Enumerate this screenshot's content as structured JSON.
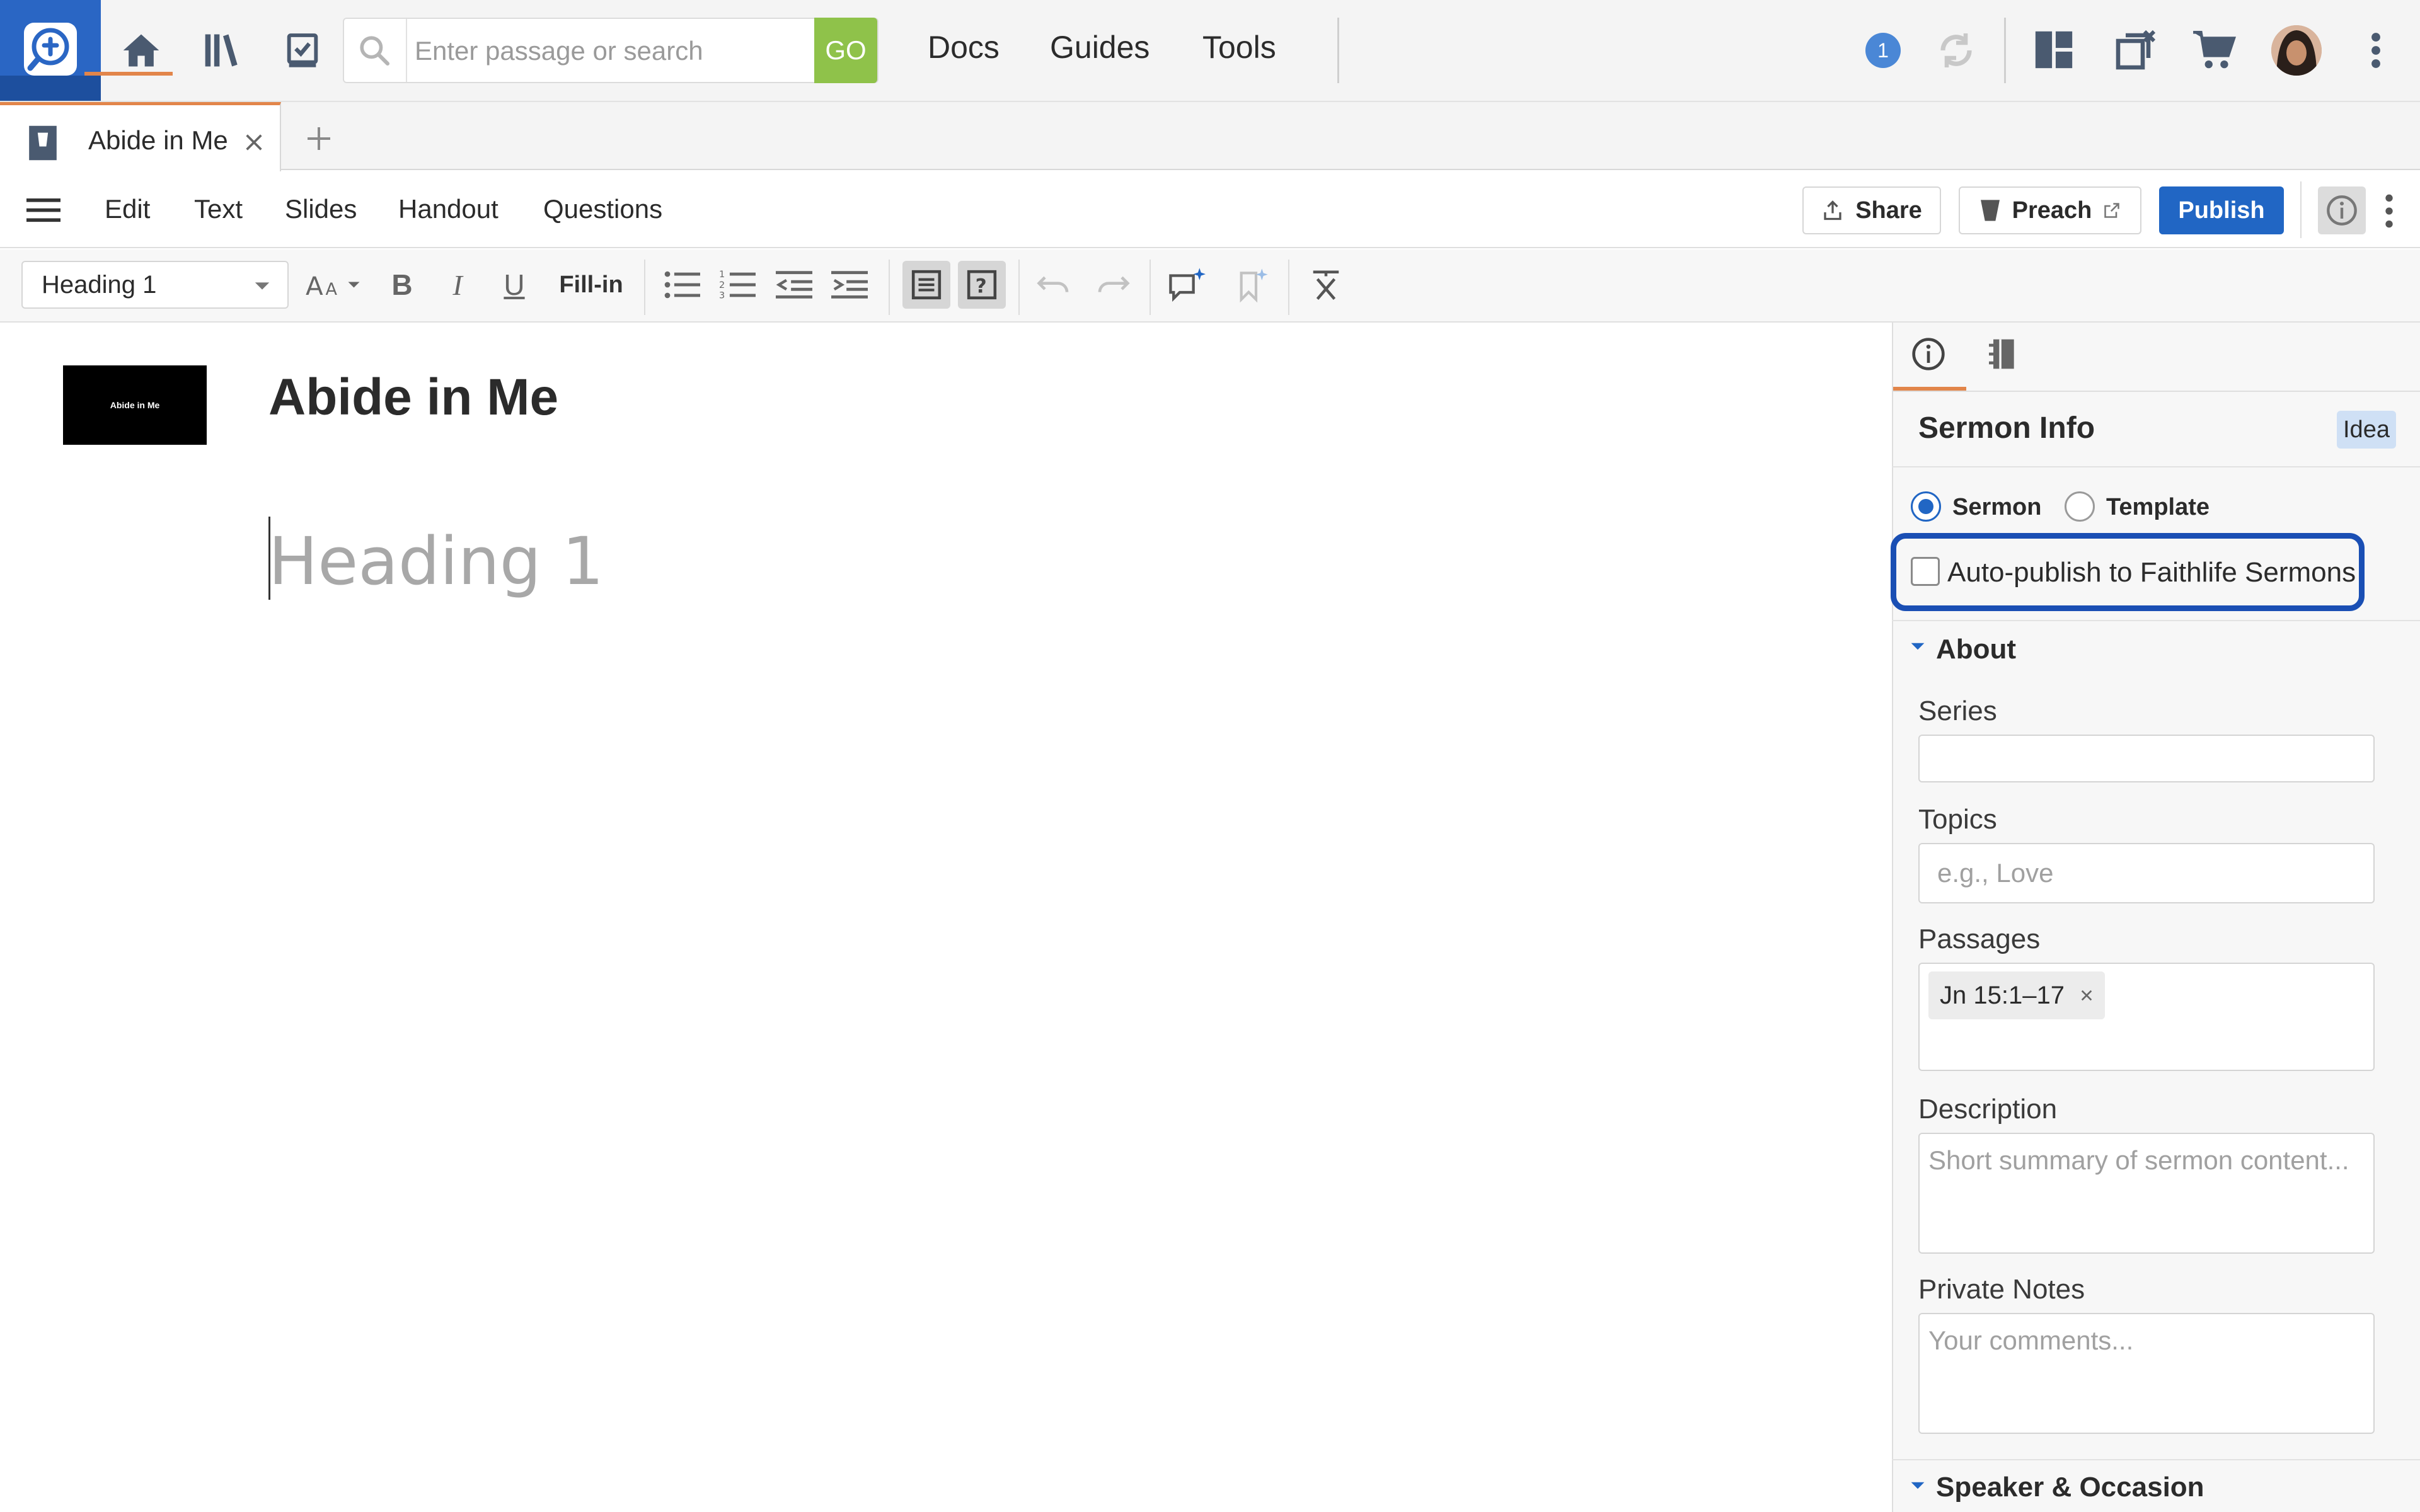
{
  "app": {
    "search_placeholder": "Enter passage or search",
    "go_label": "GO",
    "notification_count": "1"
  },
  "nav": {
    "docs": "Docs",
    "guides": "Guides",
    "tools": "Tools"
  },
  "tab": {
    "title": "Abide in Me"
  },
  "editor_tabs": {
    "edit": "Edit",
    "text": "Text",
    "slides": "Slides",
    "handout": "Handout",
    "questions": "Questions"
  },
  "actions": {
    "share": "Share",
    "preach": "Preach",
    "publish": "Publish"
  },
  "format": {
    "style_value": "Heading 1",
    "fill_in": "Fill-in",
    "bold": "B",
    "italic": "I",
    "underline": "U"
  },
  "document": {
    "thumbnail_text": "Abide in Me",
    "title": "Abide in Me",
    "heading_placeholder": "Heading 1"
  },
  "panel": {
    "title": "Sermon Info",
    "badge": "Idea",
    "type_sermon": "Sermon",
    "type_template": "Template",
    "auto_publish": "Auto-publish to Faithlife Sermons",
    "about": "About",
    "series_label": "Series",
    "topics_label": "Topics",
    "topics_placeholder": "e.g., Love",
    "passages_label": "Passages",
    "passage_tag": "Jn 15:1–17",
    "description_label": "Description",
    "description_placeholder": "Short summary of sermon content...",
    "notes_label": "Private Notes",
    "notes_placeholder": "Your comments...",
    "speaker_section": "Speaker & Occasion"
  },
  "colors": {
    "accent": "#2166c4",
    "tab_indicator": "#e2854a",
    "go_green": "#8fc24a",
    "highlight": "#1a4fb4"
  }
}
